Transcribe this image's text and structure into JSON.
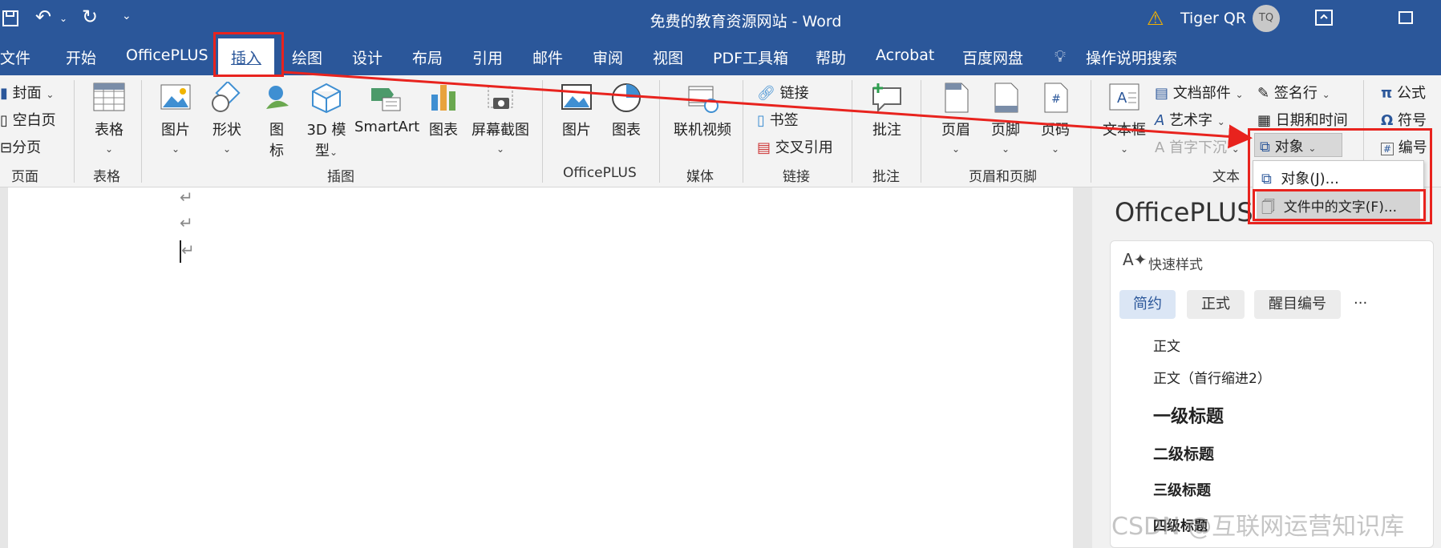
{
  "titlebar": {
    "title": "免费的教育资源网站 - Word",
    "user_name": "Tiger QR",
    "avatar_initials": "TQ"
  },
  "tabs": [
    "文件",
    "开始",
    "OfficePLUS",
    "插入",
    "绘图",
    "设计",
    "布局",
    "引用",
    "邮件",
    "审阅",
    "视图",
    "PDF工具箱",
    "帮助",
    "Acrobat",
    "百度网盘"
  ],
  "tell_me": "操作说明搜索",
  "ribbon": {
    "pages": {
      "cover": "封面",
      "blank": "空白页",
      "break": "分页",
      "group": "页面"
    },
    "table": {
      "label": "表格",
      "group": "表格"
    },
    "illustrations": {
      "picture": "图片",
      "shapes": "形状",
      "icon_a": "图",
      "icon_b": "标",
      "model_a": "3D 模",
      "model_b": "型",
      "smartart": "SmartArt",
      "chart": "图表",
      "screenshot": "屏幕截图",
      "group": "插图"
    },
    "officeplus": {
      "picture": "图片",
      "chart": "图表",
      "group": "OfficePLUS"
    },
    "media": {
      "online_video": "联机视频",
      "group": "媒体"
    },
    "links": {
      "link": "链接",
      "bookmark": "书签",
      "cross_ref": "交叉引用",
      "group": "链接"
    },
    "comments": {
      "comment": "批注",
      "group": "批注"
    },
    "header_footer": {
      "header": "页眉",
      "footer": "页脚",
      "page_number": "页码",
      "group": "页眉和页脚"
    },
    "text": {
      "textbox": "文本框",
      "doc_parts": "文档部件",
      "wordart": "艺术字",
      "dropcap": "首字下沉",
      "signature": "签名行",
      "datetime": "日期和时间",
      "object": "对象",
      "group": "文本"
    },
    "symbols": {
      "equation": "公式",
      "symbol": "符号",
      "numbering": "编号"
    }
  },
  "object_menu": {
    "items": [
      "对象(J)...",
      "文件中的文字(F)..."
    ]
  },
  "pane": {
    "title": "OfficePLUS",
    "quick_styles": "快速样式",
    "filters": [
      "简约",
      "正式",
      "醒目编号"
    ],
    "more": "···",
    "styles": [
      "正文",
      "正文（首行缩进2）",
      "一级标题",
      "二级标题",
      "三级标题",
      "四级标题"
    ]
  },
  "doc": {
    "para_mark": "↵"
  },
  "watermark": "CSDN @互联网运营知识库",
  "colors": {
    "accent": "#2b579a",
    "highlight": "#e8231e"
  }
}
